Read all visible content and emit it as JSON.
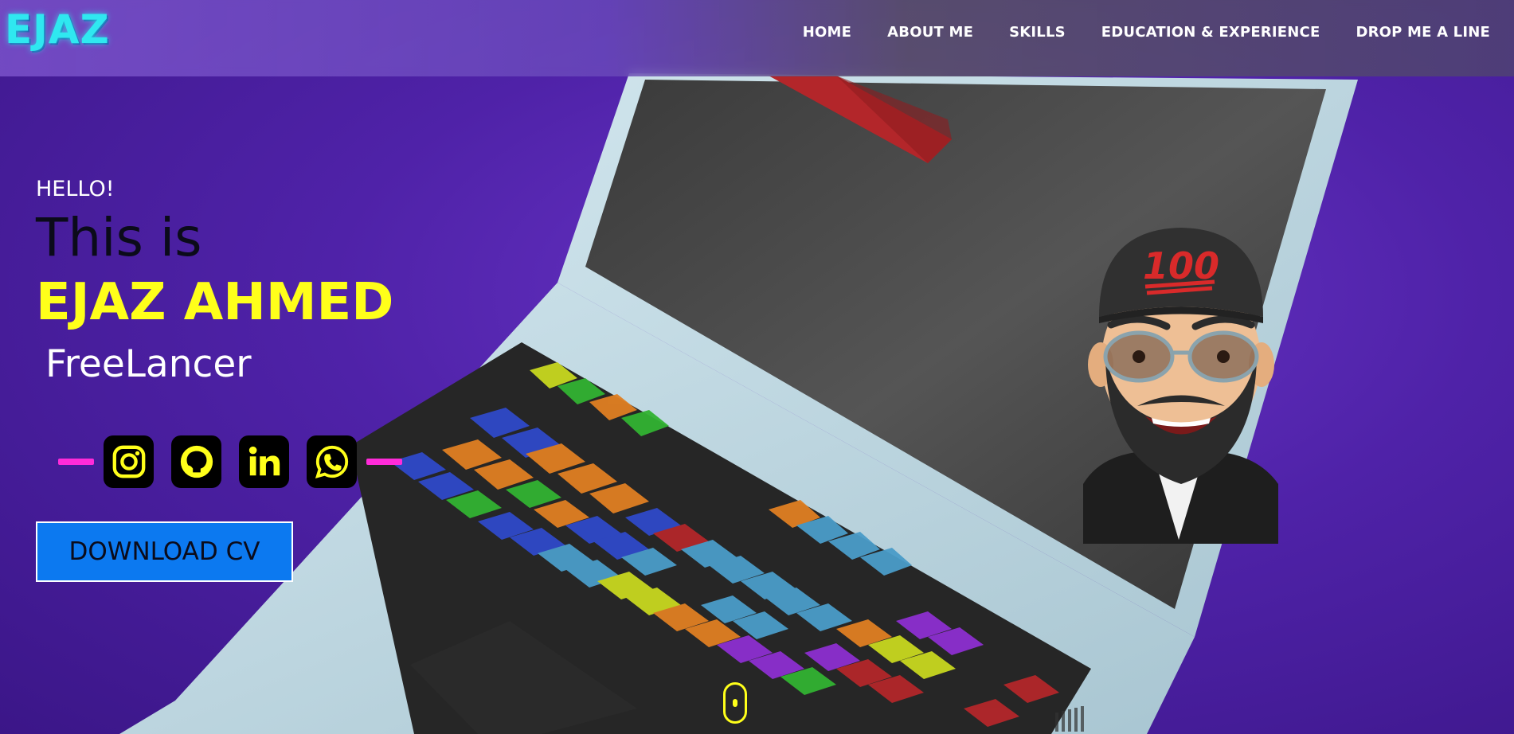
{
  "header": {
    "logo": "EJAZ",
    "nav": [
      {
        "label": "HOME"
      },
      {
        "label": "ABOUT ME"
      },
      {
        "label": "SKILLS"
      },
      {
        "label": "EDUCATION & EXPERIENCE"
      },
      {
        "label": "DROP ME A LINE"
      }
    ]
  },
  "hero": {
    "greeting": "HELLO!",
    "intro": "This is",
    "name": "EJAZ AHMED",
    "role": "FreeLancer",
    "cv_button": "DOWNLOAD CV"
  },
  "socials": [
    {
      "icon": "instagram-icon"
    },
    {
      "icon": "github-icon"
    },
    {
      "icon": "linkedin-icon"
    },
    {
      "icon": "whatsapp-icon"
    }
  ],
  "avatar": {
    "cap_text": "100"
  },
  "colors": {
    "accent_yellow": "#ffff1a",
    "logo_cyan": "#2fe8f0",
    "dash_magenta": "#ff2bd9",
    "button_blue": "#0c79f0",
    "background_purple": "#5b2bb8"
  }
}
